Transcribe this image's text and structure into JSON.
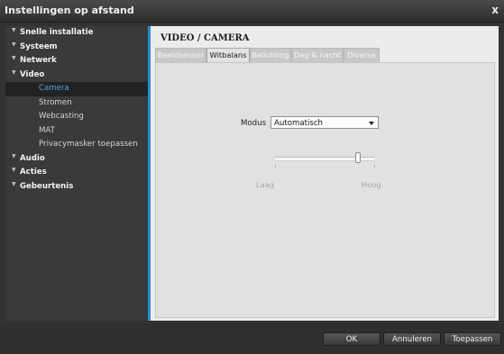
{
  "window": {
    "title": "Instellingen op afstand",
    "close_label": "x"
  },
  "sidebar": {
    "items": [
      {
        "label": "Snelle installatie",
        "level": "top"
      },
      {
        "label": "Systeem",
        "level": "top"
      },
      {
        "label": "Netwerk",
        "level": "top"
      },
      {
        "label": "Video",
        "level": "top"
      },
      {
        "label": "Camera",
        "level": "sub",
        "active": true
      },
      {
        "label": "Stromen",
        "level": "sub"
      },
      {
        "label": "Webcasting",
        "level": "sub"
      },
      {
        "label": "MAT",
        "level": "sub"
      },
      {
        "label": "Privacymasker toepassen",
        "level": "sub"
      },
      {
        "label": "Audio",
        "level": "top"
      },
      {
        "label": "Acties",
        "level": "top"
      },
      {
        "label": "Gebeurtenis",
        "level": "top"
      }
    ],
    "triangle_glyph": "▼"
  },
  "content": {
    "page_title": "VIDEO / CAMERA",
    "tabs": [
      {
        "label": "Beeldsensor"
      },
      {
        "label": "Witbalans",
        "active": true
      },
      {
        "label": "Belichting"
      },
      {
        "label": "Dag & nacht"
      },
      {
        "label": "Diverse"
      }
    ],
    "modus": {
      "label": "Modus",
      "value": "Automatisch"
    },
    "slider": {
      "min_label": "Laag",
      "max_label": "Hoog",
      "level": 0.84
    }
  },
  "footer": {
    "ok_label": "OK",
    "cancel_label": "Annuleren",
    "apply_label": "Toepassen"
  },
  "colors": {
    "accent": "#1f8fd6",
    "active_item_text": "#4fa8e2"
  }
}
